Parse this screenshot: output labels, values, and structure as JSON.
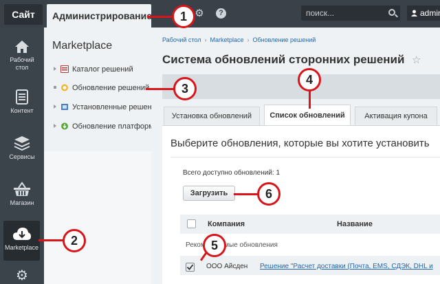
{
  "topbar": {
    "site_label": "Сайт",
    "admin_label": "Администрирование",
    "search_placeholder": "поиск...",
    "user_label": "admin"
  },
  "sidebar": {
    "items": [
      {
        "label": "Рабочий\nстол",
        "icon": "home-icon"
      },
      {
        "label": "Контент",
        "icon": "document-icon"
      },
      {
        "label": "Сервисы",
        "icon": "layers-icon"
      },
      {
        "label": "Магазин",
        "icon": "basket-icon"
      },
      {
        "label": "Marketplace",
        "icon": "cloud-download-icon"
      }
    ]
  },
  "sub_sidebar": {
    "title": "Marketplace",
    "items": [
      {
        "label": "Каталог решений"
      },
      {
        "label": "Обновление решений"
      },
      {
        "label": "Установленные решения"
      },
      {
        "label": "Обновление платформы"
      }
    ]
  },
  "main": {
    "breadcrumb": [
      "Рабочий стол",
      "Marketplace",
      "Обновление решений"
    ],
    "title": "Система обновлений сторонних решений",
    "tabs": [
      {
        "label": "Установка обновлений"
      },
      {
        "label": "Список обновлений"
      },
      {
        "label": "Активация купона"
      }
    ],
    "heading": "Выберите обновления, которые вы хотите установить",
    "total": "Всего доступно обновлений: 1",
    "load_button": "Загрузить",
    "columns": [
      "Компания",
      "Название"
    ],
    "group_row": "Рекомендуемые обновления",
    "rows": [
      {
        "company": "ООО Айсден",
        "name": "Решение \"Расчет доставки (Почта, EMS, СДЭК, DHL и"
      }
    ]
  },
  "callouts": [
    "1",
    "2",
    "3",
    "4",
    "5",
    "6"
  ],
  "colors": {
    "topbar": "#3a4149",
    "sidebar": "#3b434b",
    "link": "#2067b0",
    "callout": "#d7151a"
  }
}
